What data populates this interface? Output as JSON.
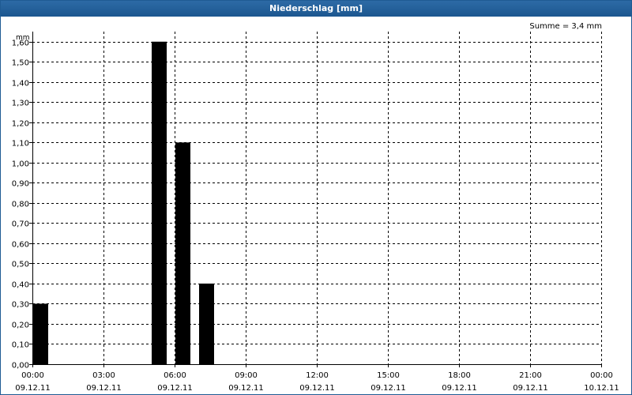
{
  "window": {
    "title": "Niederschlag [mm]"
  },
  "chart_data": {
    "type": "bar",
    "title": "Niederschlag [mm]",
    "ylabel": "mm",
    "annotation": "Summe = 3,4 mm",
    "ylim": [
      0,
      1.65
    ],
    "yticks": [
      0,
      0.1,
      0.2,
      0.3,
      0.4,
      0.5,
      0.6,
      0.7,
      0.8,
      0.9,
      1.0,
      1.1,
      1.2,
      1.3,
      1.4,
      1.5,
      1.6
    ],
    "ytick_labels": [
      "0,00",
      "0,10",
      "0,20",
      "0,30",
      "0,40",
      "0,50",
      "0,60",
      "0,70",
      "0,80",
      "0,90",
      "1,00",
      "1,10",
      "1,20",
      "1,30",
      "1,40",
      "1,50",
      "1,60"
    ],
    "x_range_hours": [
      0,
      24
    ],
    "xticks": [
      {
        "hours": 0,
        "time": "00:00",
        "date": "09.12.11"
      },
      {
        "hours": 3,
        "time": "03:00",
        "date": "09.12.11"
      },
      {
        "hours": 6,
        "time": "06:00",
        "date": "09.12.11"
      },
      {
        "hours": 9,
        "time": "09:00",
        "date": "09.12.11"
      },
      {
        "hours": 12,
        "time": "12:00",
        "date": "09.12.11"
      },
      {
        "hours": 15,
        "time": "15:00",
        "date": "09.12.11"
      },
      {
        "hours": 18,
        "time": "18:00",
        "date": "09.12.11"
      },
      {
        "hours": 21,
        "time": "21:00",
        "date": "09.12.11"
      },
      {
        "hours": 24,
        "time": "00:00",
        "date": "10.12.11"
      }
    ],
    "bars": [
      {
        "start": "00:00",
        "end": "00:40",
        "value": 0.3
      },
      {
        "start": "05:00",
        "end": "05:40",
        "value": 1.6
      },
      {
        "start": "06:00",
        "end": "06:40",
        "value": 1.1
      },
      {
        "start": "07:00",
        "end": "07:40",
        "value": 0.4
      }
    ],
    "grid": true,
    "colors": {
      "bar": "#000000",
      "grid": "#000000",
      "title_bar": "#1f5b93"
    }
  }
}
